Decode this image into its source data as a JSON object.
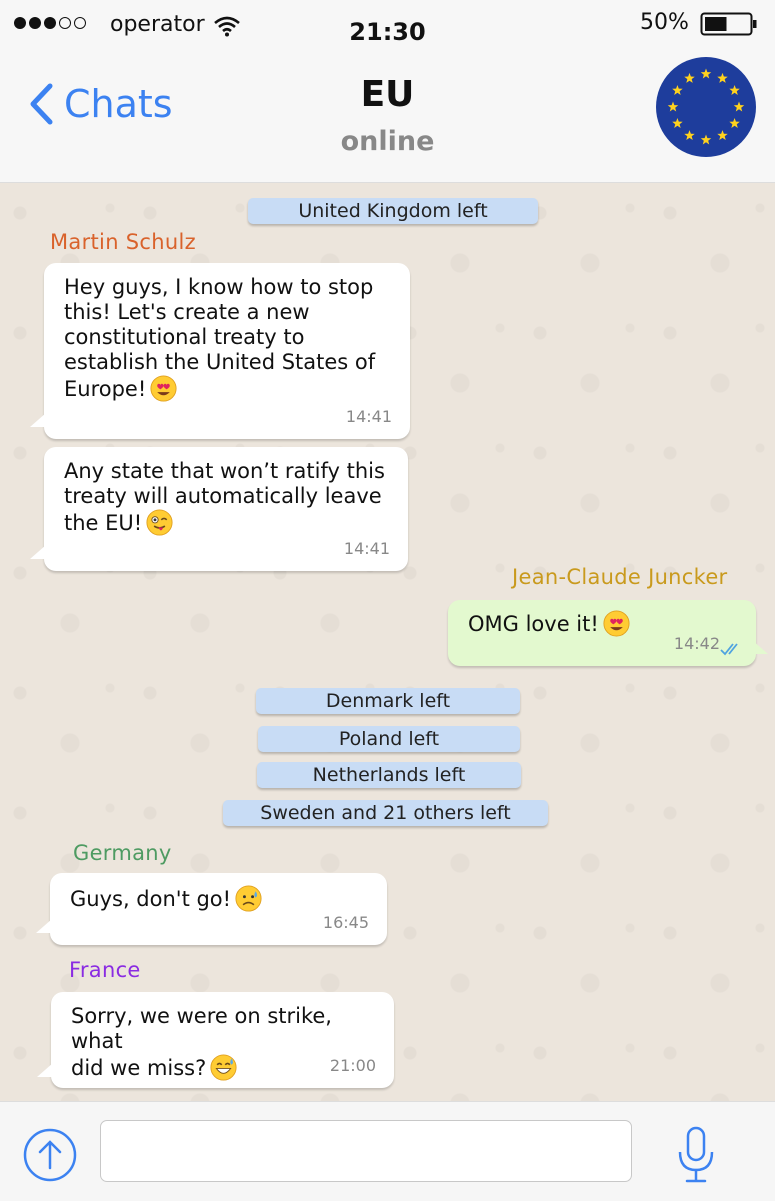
{
  "status_bar": {
    "carrier": "operator",
    "time": "21:30",
    "battery_percent": "50%",
    "battery_level": 0.5,
    "signal_bars_filled": 3,
    "signal_bars_total": 5
  },
  "header": {
    "back_label": "Chats",
    "title": "EU",
    "subtitle": "online",
    "avatar_icon": "eu-flag-icon"
  },
  "chat": {
    "system_messages": [
      "United Kingdom left",
      "Denmark left",
      "Poland left",
      "Netherlands left",
      "Sweden and 21 others left"
    ],
    "senders": {
      "schulz": {
        "name": "Martin Schulz",
        "color": "#d9622b"
      },
      "juncker": {
        "name": "Jean-Claude Juncker",
        "color": "#c99a1d"
      },
      "germany": {
        "name": "Germany",
        "color": "#4e9b62"
      },
      "france": {
        "name": "France",
        "color": "#8a2be2"
      }
    },
    "messages": [
      {
        "lines": [
          "Hey guys, I know how to stop",
          "this! Let's create a new",
          "constitutional treaty to",
          "establish the United States of",
          "Europe!"
        ],
        "emoji": "heart-eyes-emoji",
        "time": "14:41"
      },
      {
        "lines": [
          "Any state that won’t ratify this",
          "treaty will automatically leave",
          "the EU!"
        ],
        "emoji": "winking-tongue-emoji",
        "time": "14:41"
      },
      {
        "lines": [
          "OMG love it!"
        ],
        "emoji": "heart-eyes-emoji",
        "time": "14:42",
        "read_ticks": "double-check-icon"
      },
      {
        "lines": [
          "Guys, don't go!"
        ],
        "emoji": "sad-sweat-emoji",
        "time": "16:45"
      },
      {
        "lines": [
          "Sorry, we were on strike, what",
          "did we miss?"
        ],
        "emoji": "grinning-sweat-emoji",
        "time": "21:00"
      }
    ]
  },
  "input_bar": {
    "placeholder": "",
    "upload_icon": "upload-arrow-icon",
    "mic_icon": "microphone-icon"
  },
  "colors": {
    "accent_blue": "#3c82f1",
    "chat_background": "#ece5dc",
    "system_bubble": "#c8dcf5",
    "outgoing_bubble": "#e3f9cf",
    "eu_blue": "#1e3d9c",
    "eu_gold": "#ffd21e"
  }
}
